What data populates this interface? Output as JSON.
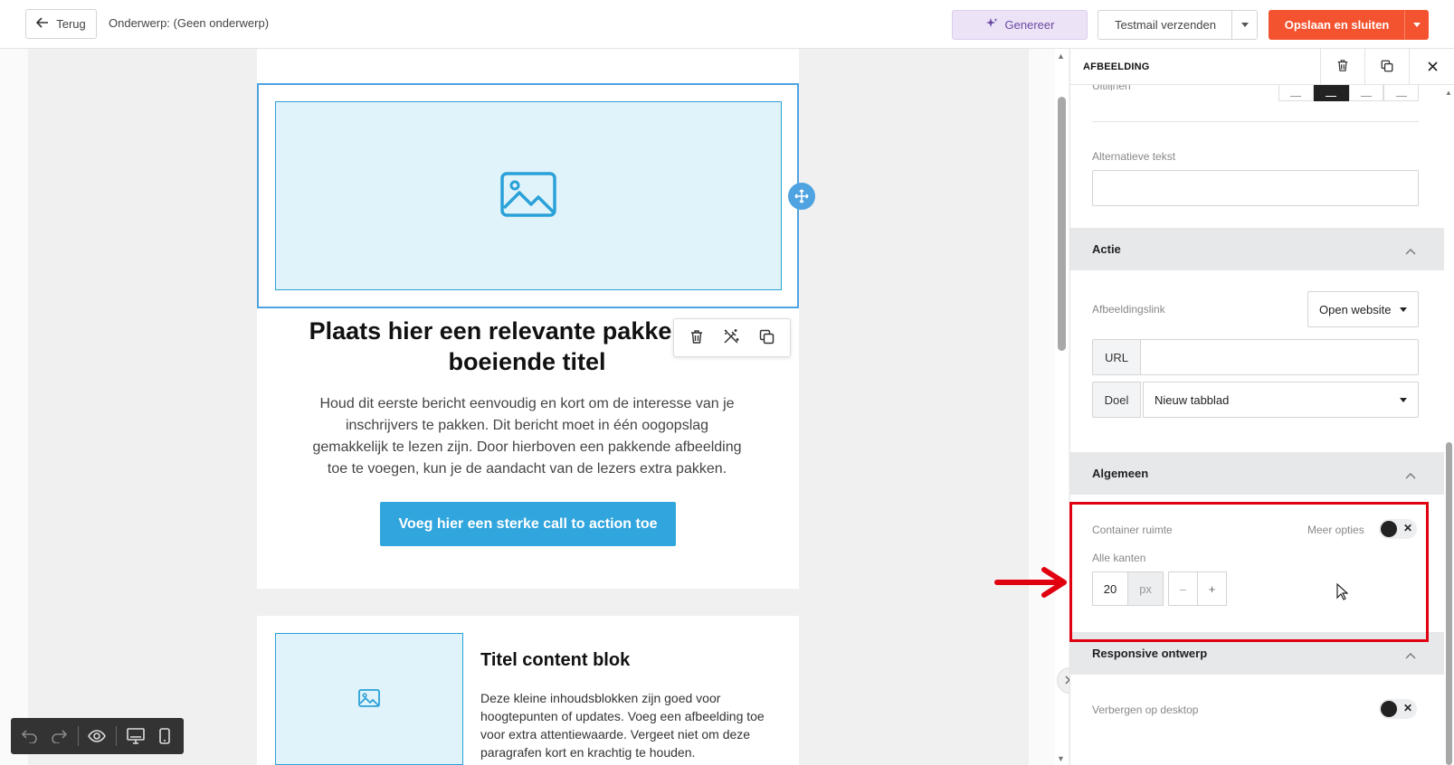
{
  "header": {
    "back_label": "Terug",
    "subject_label": "Onderwerp: (Geen onderwerp)",
    "generate_label": "Genereer",
    "testmail_label": "Testmail verzenden",
    "save_label": "Opslaan en sluiten",
    "colors": {
      "save": "#f4532f",
      "generate_bg": "#ece3f7"
    }
  },
  "canvas": {
    "hero_title": "Plaats hier een relevante pakkende of boeiende titel",
    "hero_body": "Houd dit eerste bericht eenvoudig en kort om de interesse van je inschrijvers te pakken. Dit bericht moet in één oogopslag gemakkelijk te lezen zijn. Door hierboven een pakkende afbeelding toe te voegen, kun je de aandacht van de lezers extra pakken.",
    "cta_label": "Voeg hier een sterke call to action toe",
    "block_title": "Titel content blok",
    "block_text": "Deze kleine inhoudsblokken zijn goed voor hoogtepunten of updates. Voeg een afbeelding toe voor extra attentiewaarde. Vergeet niet om deze paragrafen kort en krachtig te houden.",
    "colors": {
      "accent": "#31a5dd",
      "placeholder_bg": "#e1f3fa"
    }
  },
  "panel": {
    "title": "AFBEELDING",
    "align_label": "Uitlijnen",
    "alt_text_label": "Alternatieve tekst",
    "alt_text_value": "",
    "sections": {
      "actie": "Actie",
      "algemeen": "Algemeen",
      "responsive": "Responsive ontwerp"
    },
    "image_link_label": "Afbeeldingslink",
    "image_link_value": "Open website",
    "url_label": "URL",
    "url_value": "",
    "target_label": "Doel",
    "target_value": "Nieuw tabblad",
    "container_space_label": "Container ruimte",
    "more_options_label": "Meer opties",
    "all_sides_label": "Alle kanten",
    "padding_value": "20",
    "padding_unit": "px",
    "minus": "–",
    "plus": "+",
    "hide_desktop_label": "Verbergen op desktop",
    "highlight_color": "#e0000f"
  }
}
